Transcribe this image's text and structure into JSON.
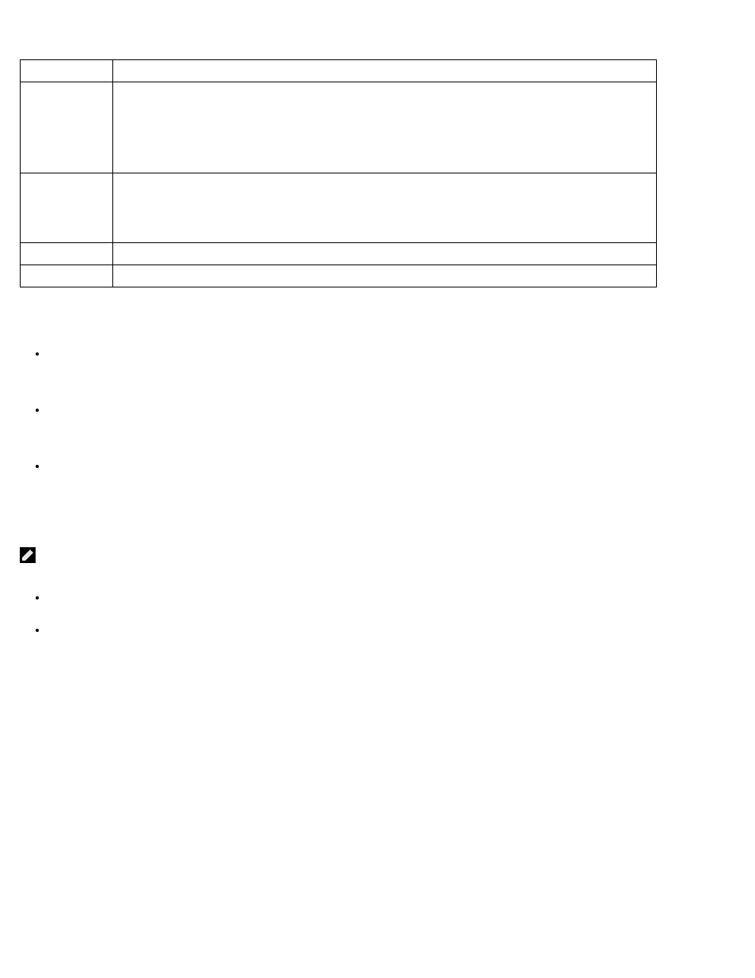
{
  "table": {
    "rows": [
      {
        "c1": "",
        "c2": ""
      },
      {
        "c1": "",
        "c2": ""
      },
      {
        "c1": "",
        "c2": ""
      },
      {
        "c1": "",
        "c2": ""
      },
      {
        "c1": "",
        "c2": ""
      }
    ]
  },
  "intro": "",
  "list1": [
    "",
    "",
    ""
  ],
  "note": "",
  "para": "",
  "list2": [
    "",
    ""
  ]
}
